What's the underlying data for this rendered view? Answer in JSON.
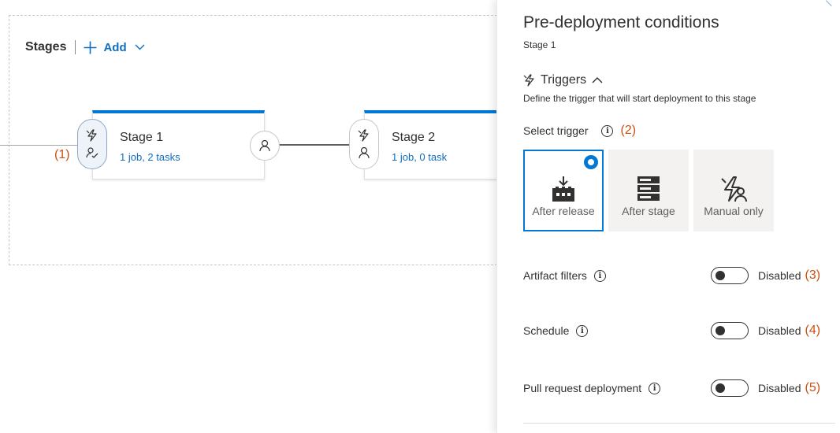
{
  "canvas": {
    "stages_title": "Stages",
    "add_label": "Add",
    "annotation_1": "(1)",
    "stages": [
      {
        "name": "Stage 1",
        "summary": "1 job, 2 tasks"
      },
      {
        "name": "Stage 2",
        "summary": "1 job, 0 task"
      }
    ]
  },
  "panel": {
    "title": "Pre-deployment conditions",
    "subtitle": "Stage 1",
    "section_title": "Triggers",
    "section_description": "Define the trigger that will start deployment to this stage",
    "select_trigger_label": "Select trigger",
    "select_trigger_annotation": "(2)",
    "trigger_options": [
      {
        "label": "After release",
        "icon": "after-release-icon",
        "selected": true
      },
      {
        "label": "After stage",
        "icon": "after-stage-icon",
        "selected": false
      },
      {
        "label": "Manual only",
        "icon": "manual-only-icon",
        "selected": false
      }
    ],
    "settings": [
      {
        "label": "Artifact filters",
        "state": "Disabled",
        "annotation": "(3)",
        "enabled": false
      },
      {
        "label": "Schedule",
        "state": "Disabled",
        "annotation": "(4)",
        "enabled": false
      },
      {
        "label": "Pull request deployment",
        "state": "Disabled",
        "annotation": "(5)",
        "enabled": false
      }
    ]
  },
  "colors": {
    "accent": "#0078d4",
    "link": "#106ebe",
    "annotation": "#ca5010",
    "text": "#323130"
  }
}
